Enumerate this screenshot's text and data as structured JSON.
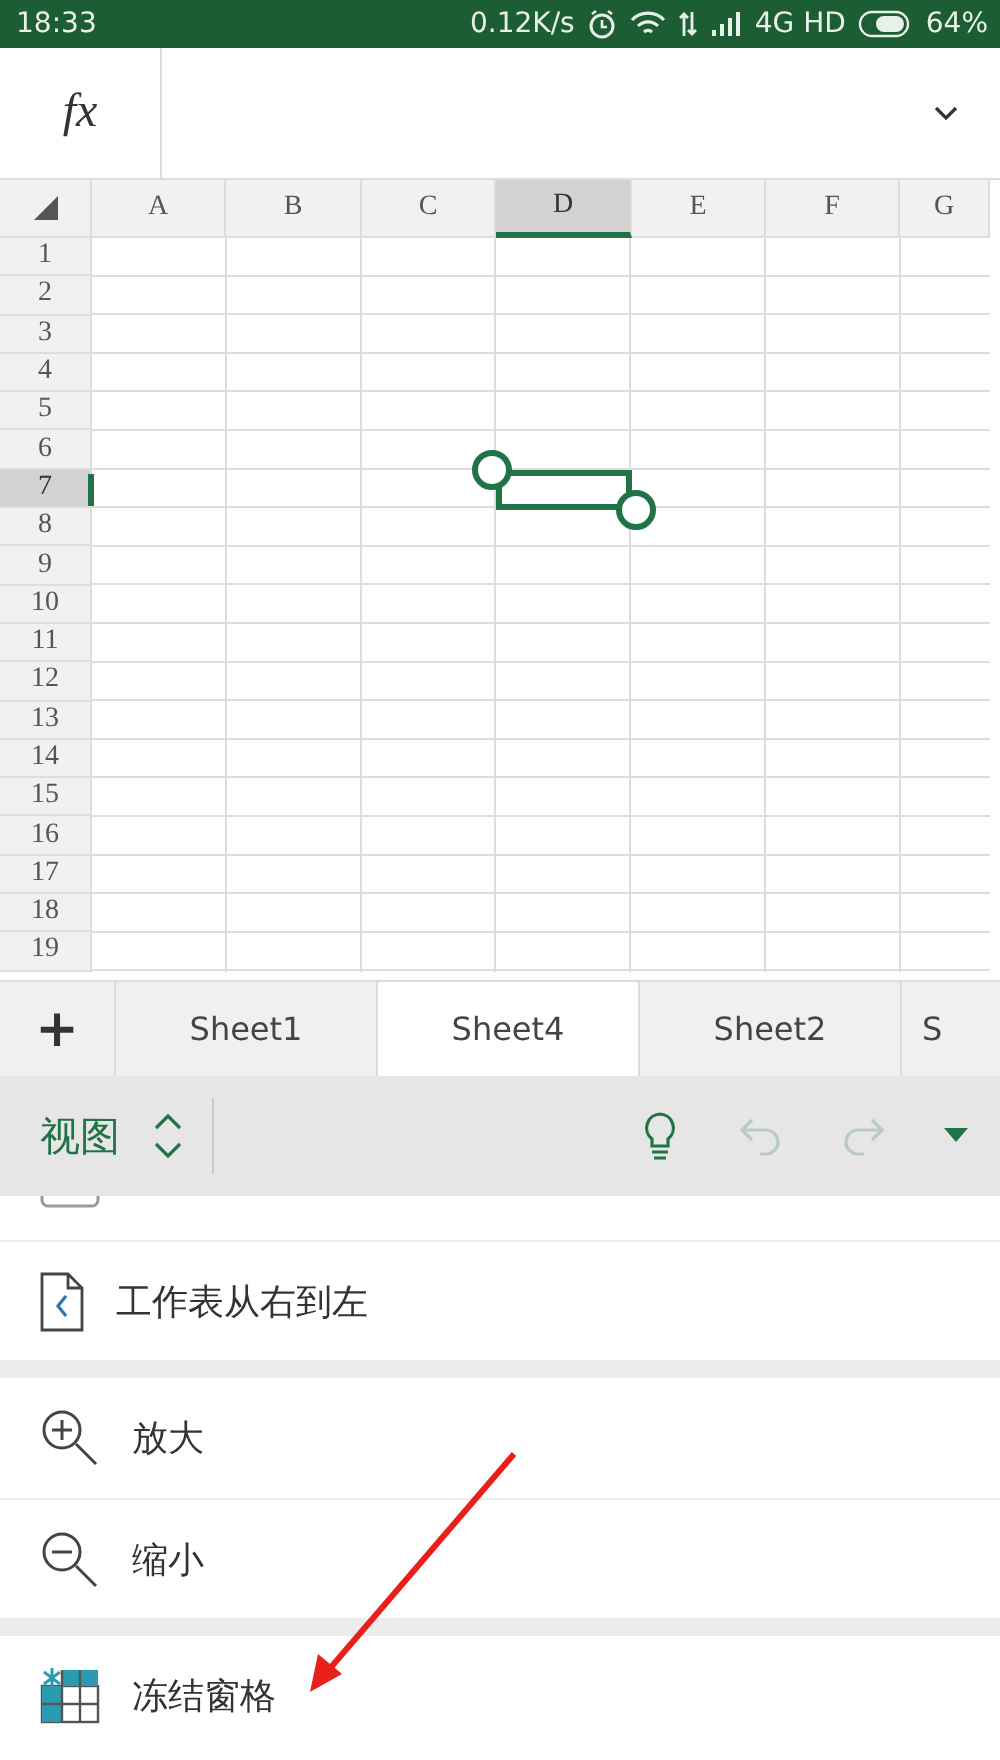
{
  "status_bar": {
    "time": "18:33",
    "speed": "0.12K/s",
    "network": "4G HD",
    "battery": "64%"
  },
  "formula_bar": {
    "label": "fx"
  },
  "grid": {
    "columns": [
      {
        "label": "A",
        "selected": false
      },
      {
        "label": "B",
        "selected": false
      },
      {
        "label": "C",
        "selected": false
      },
      {
        "label": "D",
        "selected": true
      },
      {
        "label": "E",
        "selected": false
      },
      {
        "label": "F",
        "selected": false
      },
      {
        "label": "G",
        "selected": false
      }
    ],
    "rows": [
      {
        "label": "1",
        "selected": false
      },
      {
        "label": "2",
        "selected": false
      },
      {
        "label": "3",
        "selected": false
      },
      {
        "label": "4",
        "selected": false
      },
      {
        "label": "5",
        "selected": false
      },
      {
        "label": "6",
        "selected": false
      },
      {
        "label": "7",
        "selected": true
      },
      {
        "label": "8",
        "selected": false
      },
      {
        "label": "9",
        "selected": false
      },
      {
        "label": "10",
        "selected": false
      },
      {
        "label": "11",
        "selected": false
      },
      {
        "label": "12",
        "selected": false
      },
      {
        "label": "13",
        "selected": false
      },
      {
        "label": "14",
        "selected": false
      },
      {
        "label": "15",
        "selected": false
      },
      {
        "label": "16",
        "selected": false
      },
      {
        "label": "17",
        "selected": false
      },
      {
        "label": "18",
        "selected": false
      },
      {
        "label": "19",
        "selected": false
      }
    ]
  },
  "sheet_tabs": {
    "add": "+",
    "tabs": [
      {
        "label": "Sheet1",
        "selected": false
      },
      {
        "label": "Sheet4",
        "selected": true
      },
      {
        "label": "Sheet2",
        "selected": false
      },
      {
        "label": "S",
        "selected": false
      }
    ]
  },
  "toolbar": {
    "menu": "视图",
    "undo_disabled": true,
    "redo_disabled": true
  },
  "menu_groups": [
    [
      {
        "kind": "partial"
      },
      {
        "kind": "rtl",
        "label": "工作表从右到左"
      }
    ],
    [
      {
        "kind": "zoom-in",
        "label": "放大"
      },
      {
        "kind": "zoom-out",
        "label": "缩小"
      }
    ],
    [
      {
        "kind": "freeze",
        "label": "冻结窗格"
      }
    ]
  ],
  "annotation": {
    "kind": "arrow"
  }
}
